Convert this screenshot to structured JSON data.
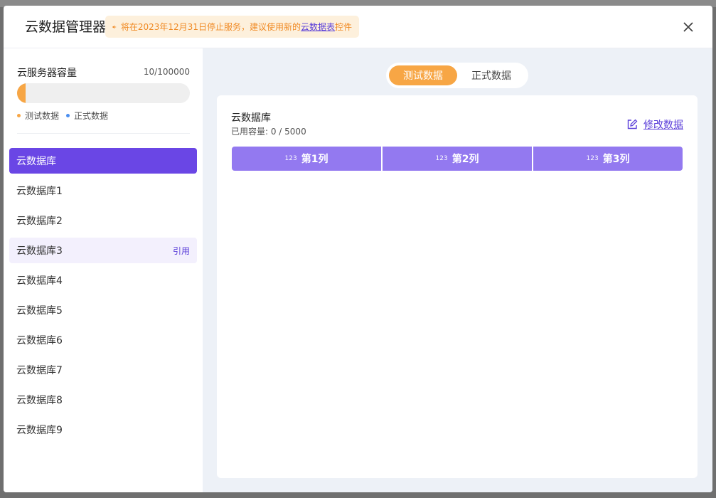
{
  "header": {
    "title": "云数据管理器",
    "notice_prefix": "将在2023年12月31日停止服务，建议使用新的",
    "notice_link": "云数据表",
    "notice_suffix": "控件"
  },
  "capacity": {
    "title": "云服务器容量",
    "count": "10/100000",
    "fill_fraction": 0.0001,
    "legend": [
      {
        "label": "测试数据",
        "color": "#f7a645"
      },
      {
        "label": "正式数据",
        "color": "#4a8ef0"
      }
    ]
  },
  "databases": [
    {
      "label": "云数据库",
      "state": "active"
    },
    {
      "label": "云数据库1"
    },
    {
      "label": "云数据库2"
    },
    {
      "label": "云数据库3",
      "state": "hover",
      "action": "引用"
    },
    {
      "label": "云数据库4"
    },
    {
      "label": "云数据库5"
    },
    {
      "label": "云数据库6"
    },
    {
      "label": "云数据库7"
    },
    {
      "label": "云数据库8"
    },
    {
      "label": "云数据库9"
    }
  ],
  "tabs": [
    {
      "label": "测试数据",
      "active": true
    },
    {
      "label": "正式数据",
      "active": false
    }
  ],
  "panel": {
    "title": "云数据库",
    "usage": "已用容量:  0   /   5000",
    "edit_label": "修改数据",
    "columns": [
      {
        "type_icon": "123",
        "label": "第1列"
      },
      {
        "type_icon": "123",
        "label": "第2列"
      },
      {
        "type_icon": "123",
        "label": "第3列"
      }
    ]
  },
  "colors": {
    "accent": "#6a46e5",
    "column_header": "#9379f0",
    "orange": "#f7a645",
    "link": "#5b3fd9"
  }
}
